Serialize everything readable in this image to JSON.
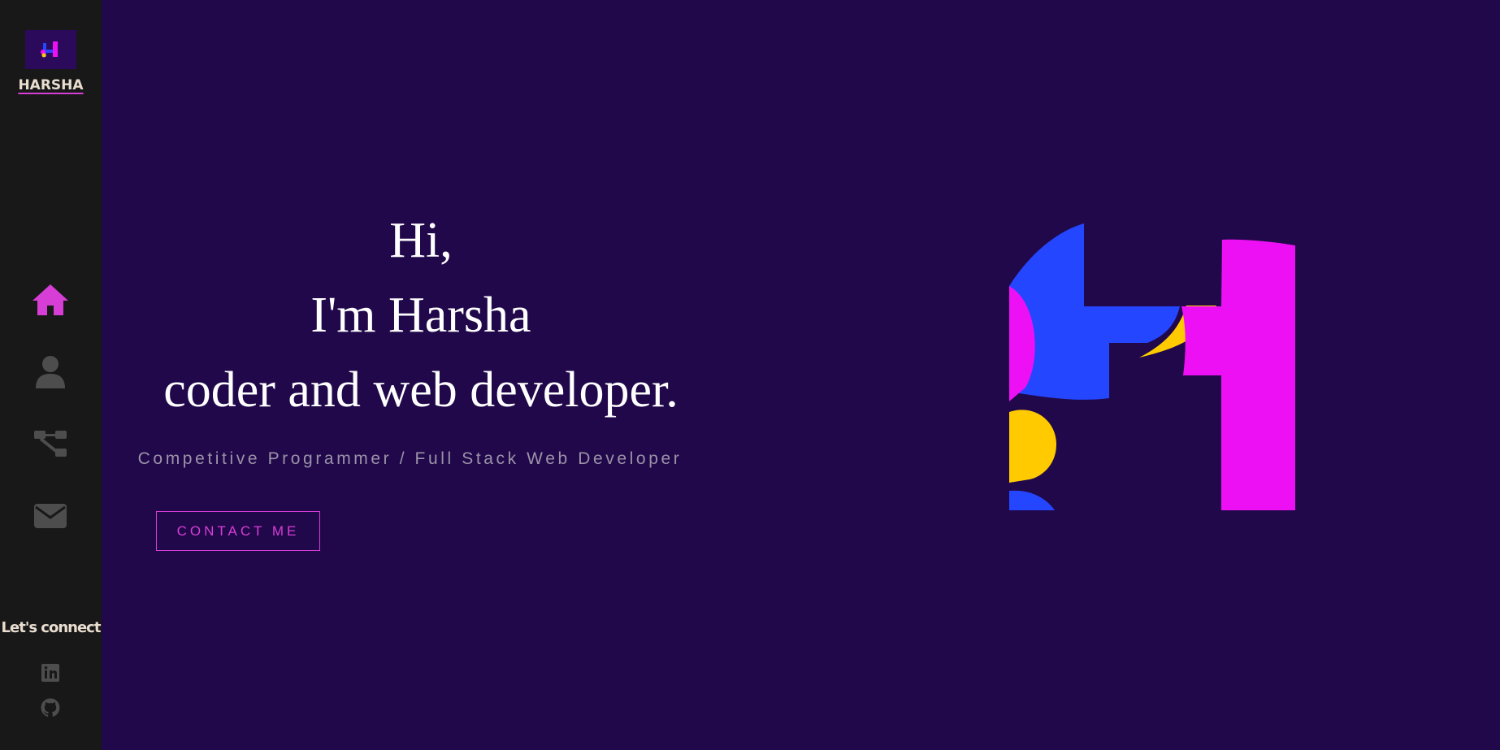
{
  "sidebar": {
    "logo_text": "HARSHA",
    "nav": [
      {
        "icon": "home-icon",
        "color": "#d63ed6"
      },
      {
        "icon": "user-icon",
        "color": "#4d4d4d"
      },
      {
        "icon": "sitemap-icon",
        "color": "#4d4d4d"
      },
      {
        "icon": "envelope-icon",
        "color": "#4d4d4d"
      }
    ],
    "connect_label": "Let's connect",
    "social": [
      {
        "icon": "linkedin-icon"
      },
      {
        "icon": "github-icon"
      }
    ]
  },
  "hero": {
    "greeting": "Hi,",
    "name_line": "I'm Harsha",
    "role_line": "coder and web developer.",
    "subtitle": "Competitive Programmer / Full Stack Web Developer",
    "contact_button": "CONTACT ME"
  },
  "colors": {
    "background": "#21084a",
    "sidebar": "#181818",
    "accent": "#d63ed6",
    "logo_blue": "#2446ff",
    "logo_magenta": "#ee10f5",
    "logo_yellow": "#ffcb00"
  }
}
